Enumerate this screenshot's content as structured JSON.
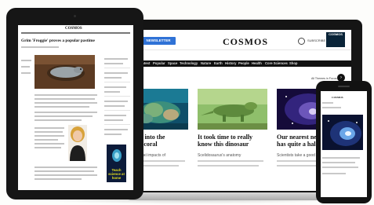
{
  "laptop": {
    "newsletter_label": "NEWSLETTER",
    "masthead": "COSMOS",
    "subscribe_label": "SUBSCRIBE",
    "magazine_label": "COSMOS",
    "nav": [
      "Latest",
      "Popular",
      "Space",
      "Technology",
      "Nature",
      "Earth",
      "History",
      "People",
      "Health",
      "Core Sciences",
      "Shop"
    ],
    "section_label": "s",
    "all_themes_label": "All Themes in Focus",
    "arrow_glyph": "›",
    "cards": [
      {
        "title_line1": "ights into the",
        "title_line2": "ty of coral",
        "blurb": "closely at impacts of"
      },
      {
        "title_line1": "It took time to really",
        "title_line2": "know this dinosaur",
        "blurb": "Scelidosaurus's anatomy"
      },
      {
        "title_line1": "Our nearest neig",
        "title_line2": "has quite a halo",
        "blurb": "Scientists take a good l"
      }
    ]
  },
  "tablet": {
    "brand": "COSMOS",
    "headline": "Grim 'Froggie' proves a popular pastime",
    "ad_text": "Teach science at home"
  },
  "phone": {
    "brand": "COSMOS"
  }
}
